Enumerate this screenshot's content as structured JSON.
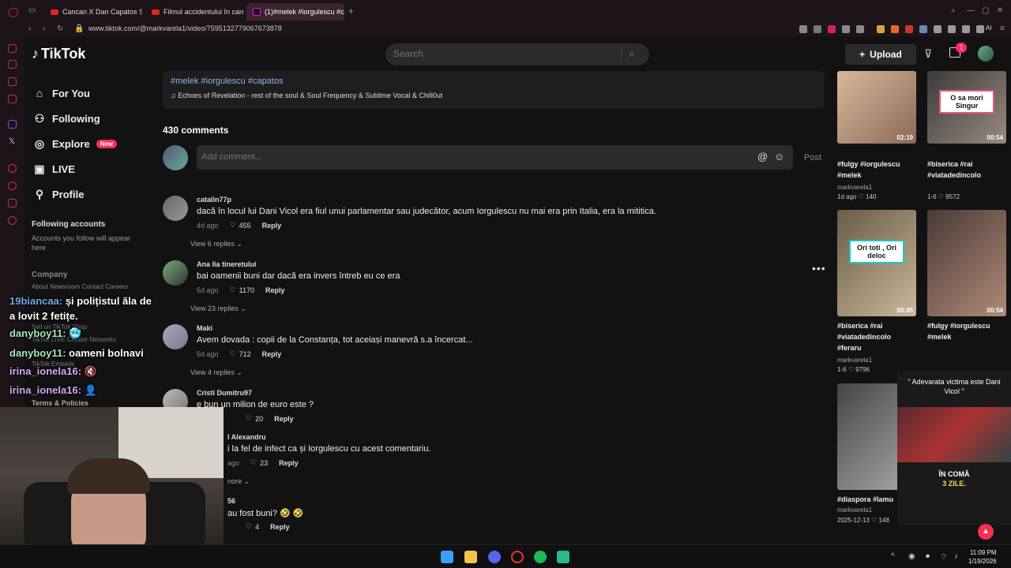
{
  "browser": {
    "tabs": [
      {
        "label": "Cancan X Dan Capatos Sh"
      },
      {
        "label": "Filmul accidentului în care"
      },
      {
        "label": "(1)#melek #iorgulescu #ca"
      }
    ],
    "url": "www.tiktok.com/@markvarela1/video/7595132779067673878",
    "ai_label": "AI",
    "new_tab": "+"
  },
  "header": {
    "logo": "TikTok",
    "search_placeholder": "Search",
    "upload_label": "Upload",
    "inbox_badge": "1"
  },
  "nav": {
    "items": [
      {
        "label": "For You",
        "icon": "home-icon"
      },
      {
        "label": "Following",
        "icon": "people-icon"
      },
      {
        "label": "Explore",
        "icon": "compass-icon",
        "badge": "New"
      },
      {
        "label": "LIVE",
        "icon": "live-icon"
      },
      {
        "label": "Profile",
        "icon": "person-icon"
      }
    ],
    "following_title": "Following accounts",
    "following_desc": "Accounts you follow will appear here",
    "company_title": "Company",
    "company_links": "About  Newsroom  Contact  Careers",
    "faint_links": [
      "Sell on TikTok Shop",
      "TikTok LIVE Creator Networks",
      "TikTok Embeds",
      "Terms & Policies"
    ]
  },
  "video": {
    "hashtags": "#melek #iorgulescu #capatos",
    "music": "♫ Echoes of Revelation - rest of the soul & Soul Frequency & Sublime Vocal & Chill0ut"
  },
  "comments_section": {
    "count": "430 comments",
    "placeholder": "Add comment...",
    "post_label": "Post",
    "comments": [
      {
        "user": "catalin77p",
        "text": "dacă în locul lui Dani Vicol era fiul unui parlamentar sau judecător, acum Iorgulescu nu mai era prin Italia, era la mititica.",
        "date": "4d ago",
        "likes": "455",
        "reply": "Reply",
        "view": "View 6 replies ⌄"
      },
      {
        "user": "Ana lia tineretului",
        "text": "bai oamenii buni dar dacă era invers întreb eu ce era",
        "date": "5d ago",
        "likes": "1170",
        "reply": "Reply",
        "view": "View 23 replies ⌄"
      },
      {
        "user": "Maki",
        "text": "Avem dovada : copii de la Constanța, tot aceiași manevră s.a încercat...",
        "date": "5d ago",
        "likes": "712",
        "reply": "Reply",
        "view": "View 4 replies ⌄"
      },
      {
        "user": "Cristi Dumitru97",
        "text": "e bun un milion de euro este ?",
        "date": "",
        "likes": "20",
        "reply": "Reply",
        "view": ""
      },
      {
        "user": "l Alexandru",
        "text": "i la fel de infect ca și Iorgulescu cu acest comentariu.",
        "date": "ago",
        "likes": "23",
        "reply": "Reply",
        "view": "nore ⌄"
      },
      {
        "user": "56",
        "text": "au fost buni? 🤣 🤣",
        "date": "",
        "likes": "4",
        "reply": "Reply",
        "view": ""
      }
    ]
  },
  "videos": [
    {
      "title": "#fulgy #iorgulescu #melek",
      "author": "markvarela1",
      "stats": "1d ago  ♡ 140",
      "duration": "02:19",
      "caption": ""
    },
    {
      "title": "#biserica #rai #viatadedincolo",
      "author": "1-6  ♡ 9572",
      "stats": "",
      "duration": "00:54",
      "caption": "O sa mori Singur"
    },
    {
      "title": "#biserica #rai #viatadedincolo #feraru",
      "author": "markvarela1",
      "stats": "1-6  ♡ 9796",
      "duration": "00:45",
      "caption": "Ori toti , Ori deloc"
    },
    {
      "title": "#fulgy #iorgulescu #melek",
      "author": "",
      "stats": "",
      "duration": "00:54",
      "caption": ""
    },
    {
      "title": "#diaspora #lamu",
      "author": "markvarela1",
      "stats": "2025-12-13  ♡ 148",
      "duration": "",
      "caption": ""
    }
  ],
  "stream": {
    "chat": [
      {
        "name": "19biancaa:",
        "msg": " și polițistul ăla de"
      },
      {
        "name": "",
        "msg": "a lovit 2 fetițe."
      },
      {
        "name": "danyboy11:",
        "msg": " 🥶"
      },
      {
        "name": "danyboy11:",
        "msg": " oameni bolnavi"
      },
      {
        "name": "irina_ionela16:",
        "msg": " 🔇"
      },
      {
        "name": "irina_ionela16:",
        "msg": " 👤"
      }
    ],
    "overlay_quote": "\" Adevarata victima este Dani Vicol \"",
    "overlay_bottom1": "ÎN COMĂ",
    "overlay_bottom2": "3 ZILE."
  },
  "taskbar": {
    "time": "11:09 PM",
    "date": "1/19/2026"
  }
}
